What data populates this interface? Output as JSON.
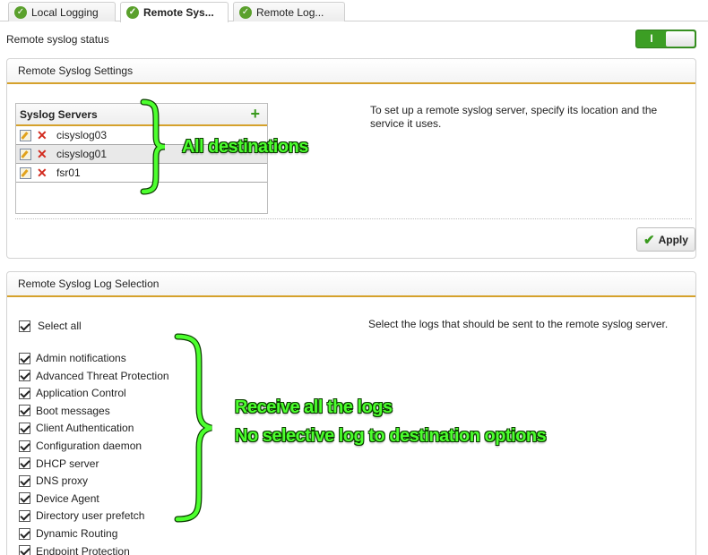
{
  "tabs": [
    {
      "label": "Local Logging",
      "active": false
    },
    {
      "label": "Remote Sys...",
      "active": true
    },
    {
      "label": "Remote Log...",
      "active": false
    }
  ],
  "status": {
    "label": "Remote syslog status",
    "toggle_state": "I"
  },
  "settings_panel": {
    "title": "Remote Syslog Settings",
    "servers_header": "Syslog Servers",
    "add_icon": "plus-icon",
    "servers": [
      {
        "name": "cisyslog03",
        "selected": false
      },
      {
        "name": "cisyslog01",
        "selected": true
      },
      {
        "name": "fsr01",
        "selected": false
      }
    ],
    "help": "To set up a remote syslog server, specify its location and the service it uses.",
    "apply_label": "Apply"
  },
  "log_panel": {
    "title": "Remote Syslog Log Selection",
    "select_all": "Select all",
    "help": "Select the logs that should be sent to the remote syslog server.",
    "logs": [
      "Admin notifications",
      "Advanced Threat Protection",
      "Application Control",
      "Boot messages",
      "Client Authentication",
      "Configuration daemon",
      "DHCP server",
      "DNS proxy",
      "Device Agent",
      "Directory user prefetch",
      "Dynamic Routing",
      "Endpoint Protection"
    ]
  },
  "annotations": {
    "destinations": "All destinations",
    "line1": "Receive all the logs",
    "line2": "No selective log to destination options"
  },
  "colors": {
    "accent": "#d5a12b",
    "toggle_on": "#3c9e24",
    "annotation": "#4cff2e",
    "delete": "#d22b1f"
  }
}
